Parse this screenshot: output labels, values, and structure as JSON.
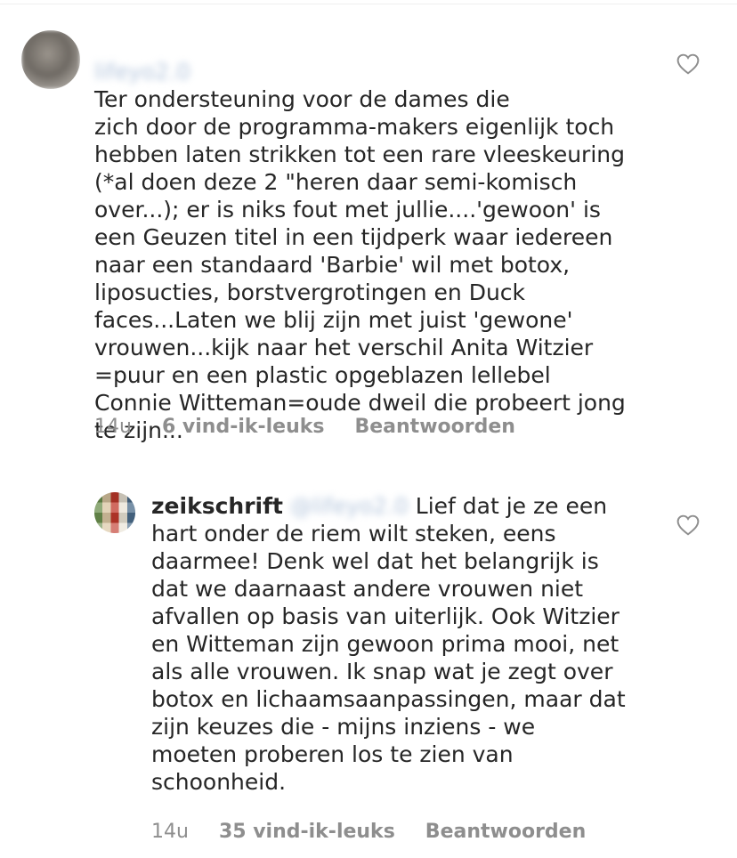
{
  "comments": [
    {
      "username_blurred": "lifeyo2.0",
      "text": "Ter ondersteuning voor de dames die\nzich door de programma-makers eigenlijk toch\nhebben laten strikken tot een rare vleeskeuring\n(*al doen deze 2 \"heren daar semi-komisch\nover...); er is niks fout met jullie....'gewoon' is\neen Geuzen titel in een tijdperk waar iedereen\nnaar een standaard 'Barbie' wil met botox,\nliposucties, borstvergrotingen en Duck\nfaces...Laten we blij zijn met juist 'gewone'\nvrouwen...kijk naar het verschil Anita Witzier\n=puur en een plastic opgeblazen lellebel\nConnie Witteman=oude dweil die probeert jong\nte zijn...",
      "time": "14u",
      "likes": "6 vind-ik-leuks",
      "reply": "Beantwoorden"
    },
    {
      "username": "zeikschrift",
      "mention_blurred": "@lifeyo2.0",
      "text_first_line": "Lief dat je ze een",
      "text": "hart onder de riem wilt steken, eens\ndaarmee! Denk wel dat het belangrijk is\ndat we daarnaast andere vrouwen niet\nafvallen op basis van uiterlijk. Ook Witzier\nen Witteman zijn gewoon prima mooi, net\nals alle vrouwen. Ik snap wat je zegt over\nbotox en lichaamsaanpassingen, maar dat\nzijn keuzes die - mijns inziens - we\nmoeten proberen los te zien van\nschoonheid.",
      "time": "14u",
      "likes": "35 vind-ik-leuks",
      "reply": "Beantwoorden"
    }
  ]
}
